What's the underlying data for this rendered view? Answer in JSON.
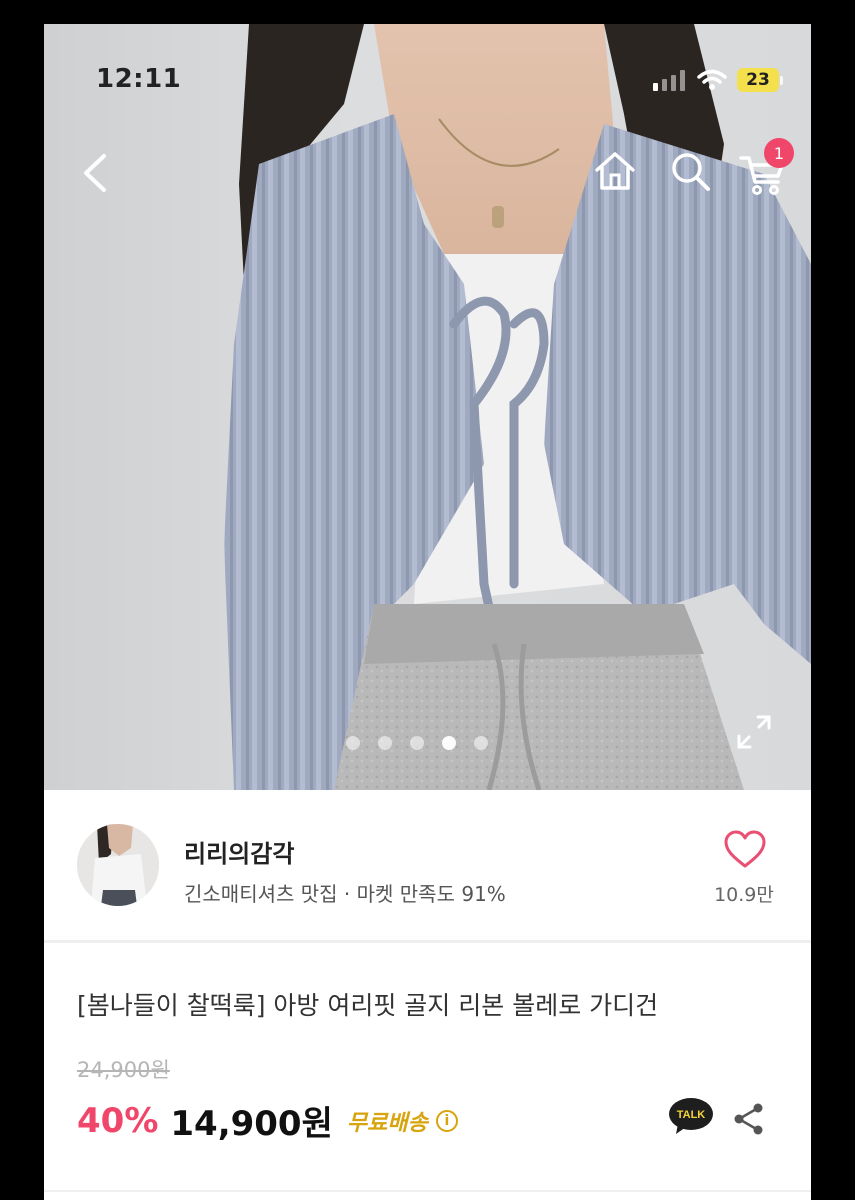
{
  "status_bar": {
    "time": "12:11",
    "battery_level": "23",
    "signal_icon": "cellular-signal-icon",
    "wifi_icon": "wifi-icon"
  },
  "nav": {
    "back_icon": "chevron-left-icon",
    "home_icon": "home-icon",
    "search_icon": "search-icon",
    "cart_icon": "shopping-cart-icon",
    "cart_badge": "1"
  },
  "carousel": {
    "slide_count": 5,
    "active_index": 4,
    "expand_icon": "expand-icon"
  },
  "seller": {
    "name": "리리의감각",
    "description": "긴소매티셔츠 맛집 · 마켓 만족도 91%",
    "like_count": "10.9만",
    "like_icon": "heart-icon"
  },
  "product": {
    "title": "[봄나들이 찰떡룩] 아방 여리핏 골지 리본 볼레로 가디건",
    "original_price": "24,900원",
    "discount": "40%",
    "price": "14,900원",
    "shipping": "무료배송",
    "info_icon_text": "i",
    "talk_icon": "talk-icon",
    "talk_label": "TALK",
    "share_icon": "share-icon"
  },
  "colors": {
    "accent_pink": "#f0466a",
    "shipping_gold": "#d7a40b",
    "battery_yellow": "#f4e04d"
  }
}
